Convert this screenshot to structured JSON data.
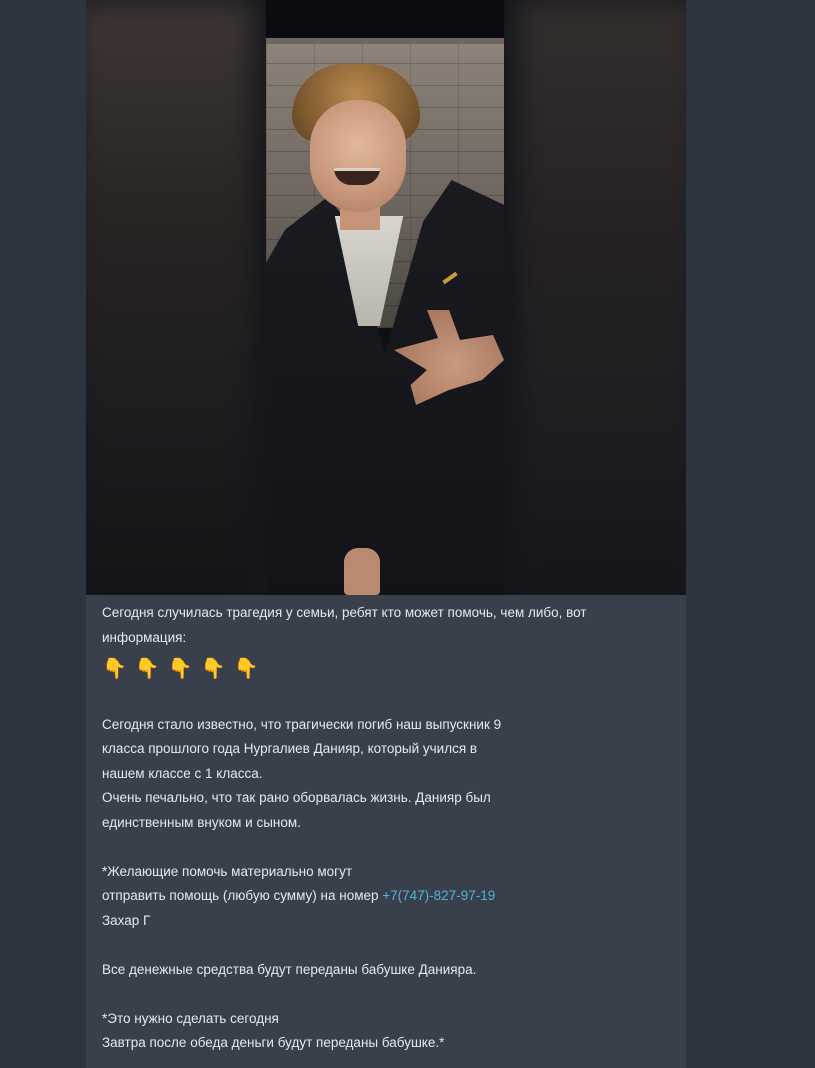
{
  "message": {
    "intro": "Сегодня случилась трагедия у семьи, ребят кто может помочь, чем либо, вот информация:",
    "emojis": [
      "👇",
      "👇",
      "👇",
      "👇",
      "👇"
    ],
    "paragraph_1_lines": [
      "Сегодня стало известно, что трагически погиб наш выпускник 9",
      "класса прошлого года Нургалиев Данияр, который учился в",
      "нашем классе с 1 класса.",
      "Очень печально, что так рано оборвалась жизнь. Данияр был",
      "единственным внуком и сыном."
    ],
    "help_line_1": "*Желающие помочь материально могут",
    "help_line_2_prefix": "отправить помощь (любую сумму) на номер",
    "phone": "+7(747)-827-97-19",
    "help_name": "Захар Г",
    "funds_note": "Все денежные средства будут переданы бабушке Данияра.",
    "urgent_line_1": "*Это нужно сделать сегодня",
    "urgent_line_2": "Завтра после обеда деньги будут переданы бабушке.*"
  },
  "colors": {
    "chat_background": "#2d333e",
    "bubble_background": "#3a404b",
    "text": "#e6e8ec",
    "link": "#4fb3d8"
  },
  "icons": {
    "pointing_down": "pointing-down-emoji"
  }
}
